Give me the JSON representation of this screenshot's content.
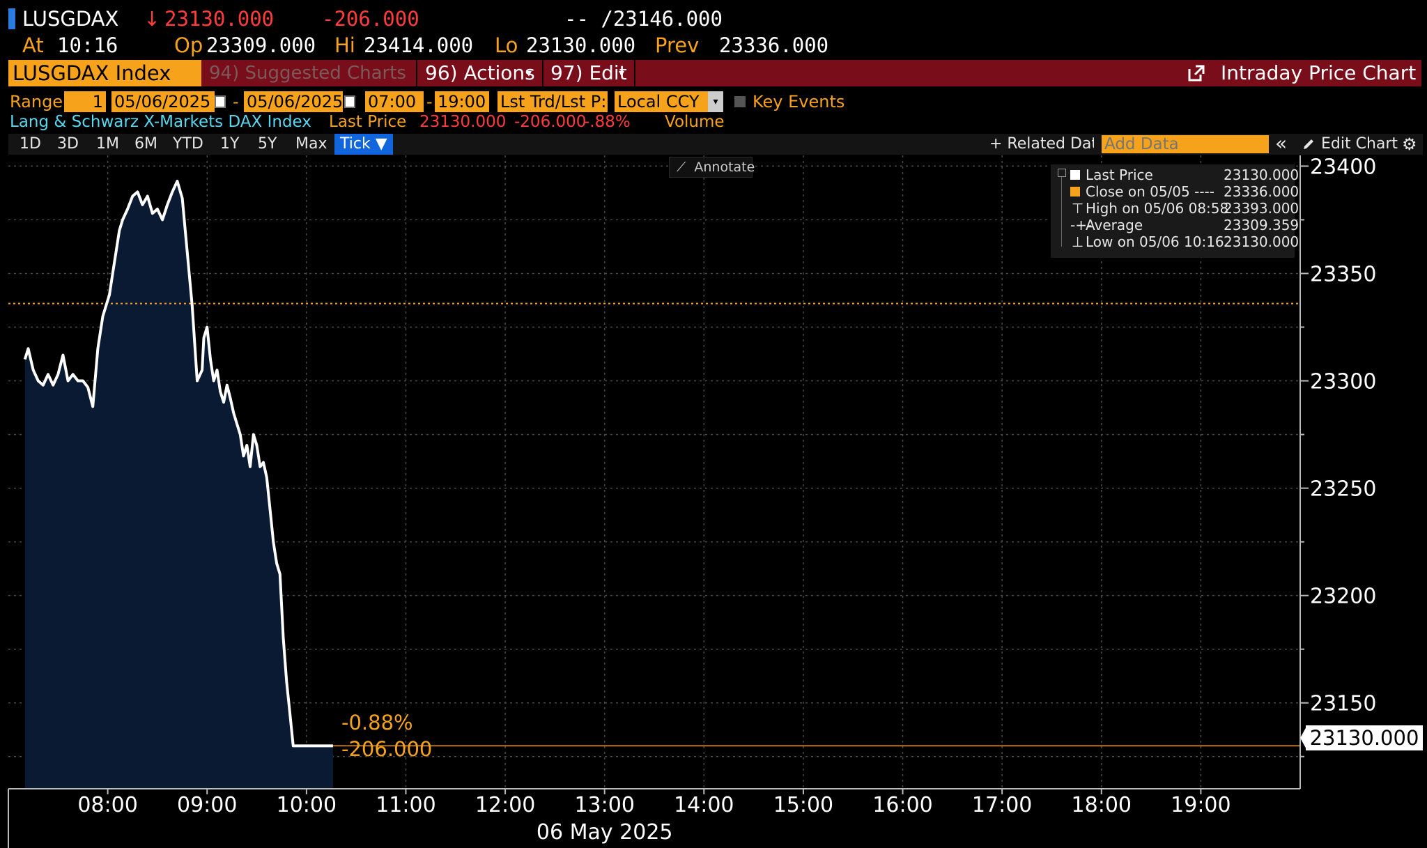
{
  "header": {
    "ticker": "LUSGDAX",
    "last_arrow": "↓",
    "last": "23130.000",
    "change": "-206.000",
    "bid_ask": "-- /23146.000",
    "at_label": "At",
    "time": "10:16",
    "open_label": "Op",
    "open": "23309.000",
    "high_label": "Hi",
    "high": "23414.000",
    "low_label": "Lo",
    "low": "23130.000",
    "prev_label": "Prev",
    "prev": "23336.000"
  },
  "command_bar": {
    "security": "LUSGDAX Index",
    "menu_suggested": "94) Suggested Charts",
    "menu_actions": "96) Actions",
    "menu_edit": "97) Edit",
    "title": "Intraday Price Chart"
  },
  "settings": {
    "range_label": "Range",
    "range_value": "1",
    "start_date": "05/06/2025",
    "dash": "-",
    "end_date": "05/06/2025",
    "start_time": "07:00",
    "end_time": "19:00",
    "price_type": "Lst Trd/Lst P:",
    "currency": "Local CCY",
    "key_events": "Key Events"
  },
  "info": {
    "security_name": "Lang & Schwarz X-Markets DAX Index",
    "last_price_label": "Last Price",
    "last_price": "23130.000",
    "change": "-206.000",
    "change_pct": "-.88%",
    "volume_label": "Volume"
  },
  "periods": [
    "1D",
    "3D",
    "1M",
    "6M",
    "YTD",
    "1Y",
    "5Y",
    "Max"
  ],
  "tick_label": "Tick ▼",
  "toolbar": {
    "related_data": "+ Related Dat",
    "add_data_placeholder": "Add Data",
    "collapse": "«",
    "edit_chart": "Edit Chart",
    "annotate": "Annotate"
  },
  "legend": [
    {
      "label": "Last Price",
      "value": "23130.000",
      "color": "#ffffff"
    },
    {
      "label": "Close on 05/05 ----",
      "value": "23336.000",
      "color": "#f7a21b"
    },
    {
      "label": "High on 05/06 08:58",
      "value": "23393.000",
      "color": "#cccccc"
    },
    {
      "label": "Average",
      "value": "23309.359",
      "color": "#cccccc"
    },
    {
      "label": "Low on 05/06 10:16",
      "value": "23130.000",
      "color": "#cccccc"
    }
  ],
  "annotations": {
    "pct": "-0.88%",
    "abs": "-206.000",
    "last_tag": "23130.000"
  },
  "colors": {
    "amber": "#f7a21b",
    "red": "#ff3b3b",
    "area_fill": "#0b1a33",
    "grid": "#4a4a4a",
    "command_bar": "#7a0d1a"
  },
  "chart_data": {
    "type": "area",
    "x_axis_date": "06 May 2025",
    "x_ticks": [
      "08:00",
      "09:00",
      "10:00",
      "11:00",
      "12:00",
      "13:00",
      "14:00",
      "15:00",
      "16:00",
      "17:00",
      "18:00",
      "19:00"
    ],
    "y_ticks": [
      23150,
      23200,
      23250,
      23300,
      23350,
      23400
    ],
    "ylim": [
      23110,
      23405
    ],
    "xlim": [
      "07:00",
      "20:00"
    ],
    "prev_close": 23336,
    "last": 23130,
    "series": [
      {
        "x": [
          "07:10",
          "07:12",
          "07:15",
          "07:18",
          "07:21",
          "07:24",
          "07:27",
          "07:30",
          "07:33",
          "07:36",
          "07:39",
          "07:42",
          "07:45",
          "07:48",
          "07:51",
          "07:54",
          "07:57",
          "07:59",
          "08:01",
          "08:03",
          "08:05",
          "08:07",
          "08:09",
          "08:12",
          "08:15",
          "08:18",
          "08:21",
          "08:24",
          "08:27",
          "08:30",
          "08:33",
          "08:36",
          "08:39",
          "08:42",
          "08:45",
          "08:48",
          "08:51",
          "08:54",
          "08:57",
          "08:58",
          "09:00",
          "09:02",
          "09:04",
          "09:06",
          "09:08",
          "09:10",
          "09:12",
          "09:14",
          "09:16",
          "09:18",
          "09:20",
          "09:22",
          "09:24",
          "09:26",
          "09:28",
          "09:30",
          "09:32",
          "09:34",
          "09:36",
          "09:38",
          "09:40",
          "09:42",
          "09:44",
          "09:46",
          "09:48",
          "09:50",
          "09:52",
          "09:54",
          "09:56",
          "09:58",
          "10:00",
          "10:02",
          "10:04",
          "10:06",
          "10:08",
          "10:10",
          "10:12",
          "10:14",
          "10:16"
        ],
        "y": [
          23310,
          23315,
          23305,
          23300,
          23298,
          23303,
          23298,
          23303,
          23312,
          23300,
          23303,
          23300,
          23300,
          23297,
          23288,
          23315,
          23330,
          23335,
          23340,
          23350,
          23360,
          23370,
          23375,
          23380,
          23386,
          23388,
          23382,
          23386,
          23378,
          23380,
          23375,
          23382,
          23388,
          23393,
          23385,
          23360,
          23335,
          23300,
          23305,
          23320,
          23325,
          23310,
          23300,
          23305,
          23295,
          23290,
          23298,
          23292,
          23285,
          23280,
          23275,
          23265,
          23270,
          23260,
          23275,
          23270,
          23260,
          23262,
          23255,
          23240,
          23225,
          23215,
          23210,
          23180,
          23160,
          23145,
          23130,
          23130,
          23130,
          23130,
          23130,
          23130,
          23130,
          23130,
          23130,
          23130,
          23130,
          23130,
          23130
        ]
      }
    ]
  }
}
